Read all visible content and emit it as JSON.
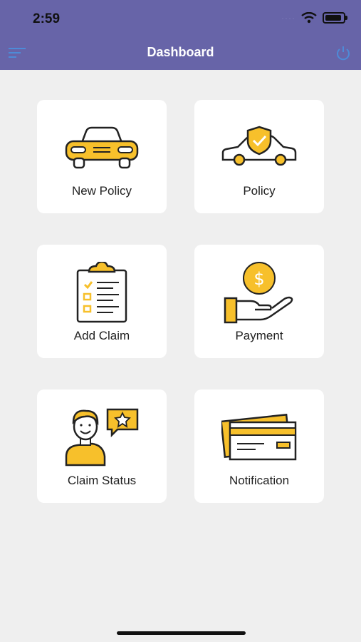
{
  "status_bar": {
    "time": "2:59"
  },
  "header": {
    "title": "Dashboard"
  },
  "tiles": [
    {
      "label": "New Policy",
      "icon": "car-front-icon"
    },
    {
      "label": "Policy",
      "icon": "car-shield-icon"
    },
    {
      "label": "Add Claim",
      "icon": "clipboard-checklist-icon"
    },
    {
      "label": "Payment",
      "icon": "hand-coin-icon"
    },
    {
      "label": "Claim Status",
      "icon": "person-star-icon"
    },
    {
      "label": "Notification",
      "icon": "credit-card-icon"
    }
  ],
  "colors": {
    "header": "#6764a8",
    "accent": "#f7c02b",
    "outline": "#222222",
    "background": "#efefef"
  }
}
